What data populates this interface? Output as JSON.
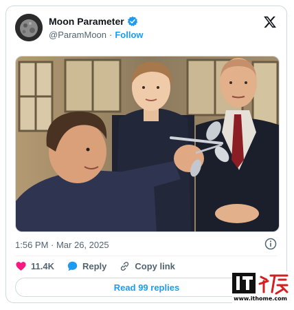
{
  "tweet": {
    "display_name": "Moon Parameter",
    "handle": "@ParamMoon",
    "separator": "·",
    "follow_label": "Follow",
    "timestamp": "1:56 PM · Mar 26, 2025",
    "likes": "11.4K",
    "reply_label": "Reply",
    "copy_link_label": "Copy link",
    "read_replies_label": "Read 99 replies"
  },
  "icons": {
    "verified": "verified-badge-icon",
    "brand": "x-logo-icon",
    "info": "info-icon",
    "like": "heart-icon",
    "reply": "reply-bubble-icon",
    "link": "link-icon"
  },
  "watermark": {
    "logo_text": "IT之家",
    "url": "www.ithome.com"
  },
  "colors": {
    "accent": "#1d9bf0",
    "like": "#f91880",
    "muted": "#536471",
    "border": "#cfd9de",
    "watermark": "#d21f1f"
  }
}
